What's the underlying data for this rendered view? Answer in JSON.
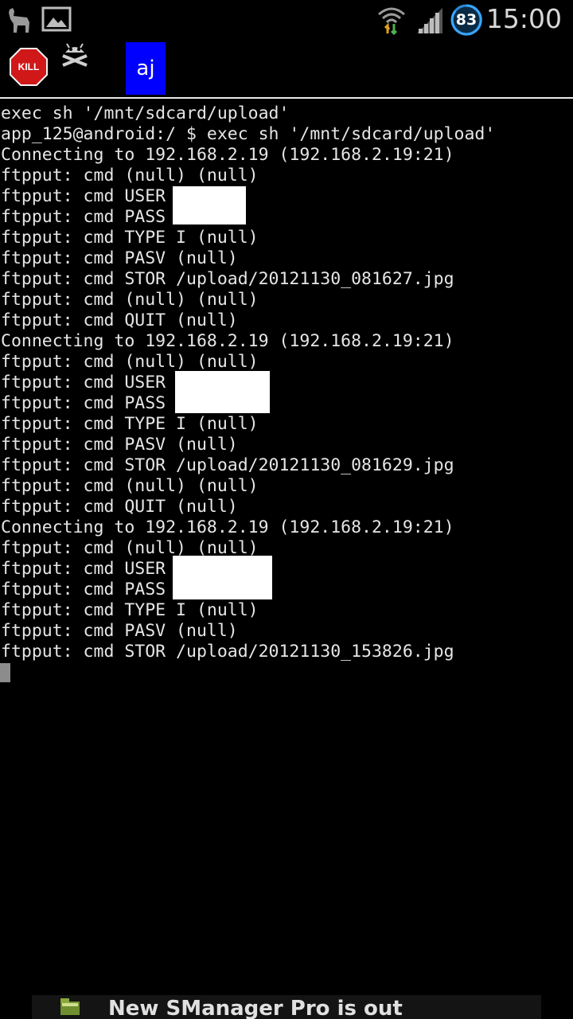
{
  "status_bar": {
    "time": "15:00",
    "battery_level": "83",
    "icons": [
      "llama-icon",
      "image-icon",
      "wifi-icon",
      "signal-icon",
      "battery-icon"
    ]
  },
  "toolbar": {
    "kill_label": "KILL",
    "aj_label": "aj",
    "icons": [
      "kill-stop-icon",
      "android-skull-icon"
    ]
  },
  "terminal": {
    "lines": [
      "exec sh '/mnt/sdcard/upload'",
      "app_125@android:/ $ exec sh '/mnt/sdcard/upload'",
      "Connecting to 192.168.2.19 (192.168.2.19:21)",
      "ftpput: cmd (null) (null)",
      "ftpput: cmd USER",
      "ftpput: cmd PASS",
      "ftpput: cmd TYPE I (null)",
      "ftpput: cmd PASV (null)",
      "ftpput: cmd STOR /upload/20121130_081627.jpg",
      "ftpput: cmd (null) (null)",
      "ftpput: cmd QUIT (null)",
      "Connecting to 192.168.2.19 (192.168.2.19:21)",
      "ftpput: cmd (null) (null)",
      "ftpput: cmd USER",
      "ftpput: cmd PASS",
      "ftpput: cmd TYPE I (null)",
      "ftpput: cmd PASV (null)",
      "ftpput: cmd STOR /upload/20121130_081629.jpg",
      "ftpput: cmd (null) (null)",
      "ftpput: cmd QUIT (null)",
      "Connecting to 192.168.2.19 (192.168.2.19:21)",
      "ftpput: cmd (null) (null)",
      "ftpput: cmd USER",
      "ftpput: cmd PASS",
      "ftpput: cmd TYPE I (null)",
      "ftpput: cmd PASV (null)",
      "ftpput: cmd STOR /upload/20121130_153826.jpg"
    ]
  },
  "notification": {
    "text": "New SManager Pro is out",
    "icon": "folder-icon"
  }
}
